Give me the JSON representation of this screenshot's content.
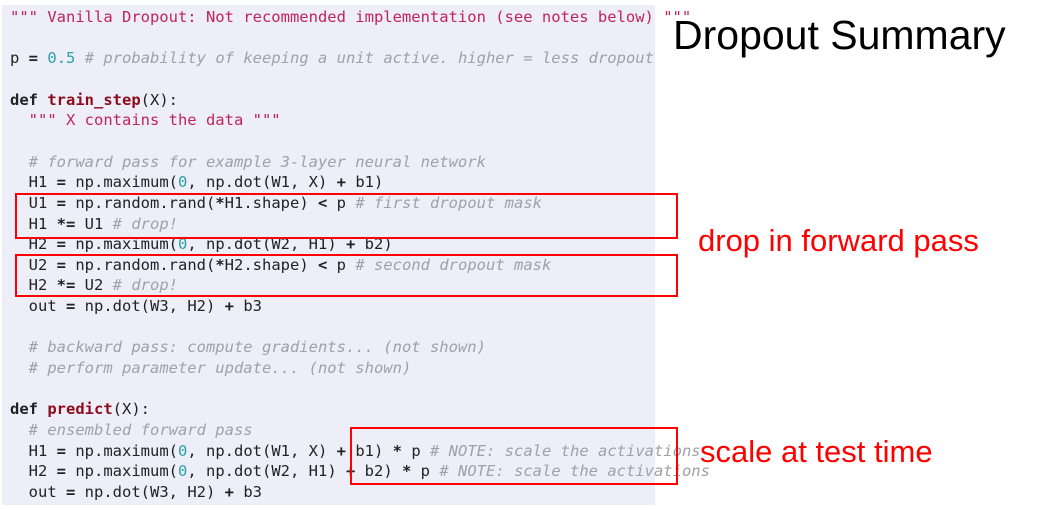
{
  "title": "Dropout Summary",
  "annotations": {
    "forward": "drop in forward pass",
    "test": "scale at test time"
  },
  "colors": {
    "highlight": "#ff0000",
    "code_bg": "#eeeef8",
    "string": "#c0245a",
    "comment": "#a0a0a8",
    "number": "#2aa1a6",
    "funcname": "#8b0b1a"
  },
  "code_lines": [
    [
      [
        "s",
        "\"\"\" Vanilla Dropout: Not recommended implementation (see notes below) \"\"\""
      ]
    ],
    [],
    [
      [
        "p",
        "p "
      ],
      [
        "o",
        "="
      ],
      [
        "p",
        " "
      ],
      [
        "n",
        "0.5"
      ],
      [
        "p",
        " "
      ],
      [
        "c",
        "# probability of keeping a unit active. higher = less dropout"
      ]
    ],
    [],
    [
      [
        "k",
        "def"
      ],
      [
        "p",
        " "
      ],
      [
        "f",
        "train_step"
      ],
      [
        "p",
        "(X):"
      ]
    ],
    [
      [
        "p",
        "  "
      ],
      [
        "s",
        "\"\"\" X contains the data \"\"\""
      ]
    ],
    [],
    [
      [
        "p",
        "  "
      ],
      [
        "c",
        "# forward pass for example 3-layer neural network"
      ]
    ],
    [
      [
        "p",
        "  H1 "
      ],
      [
        "o",
        "="
      ],
      [
        "p",
        " np.maximum("
      ],
      [
        "n",
        "0"
      ],
      [
        "p",
        ", np.dot(W1, X) "
      ],
      [
        "o",
        "+"
      ],
      [
        "p",
        " b1)"
      ]
    ],
    [
      [
        "p",
        "  U1 "
      ],
      [
        "o",
        "="
      ],
      [
        "p",
        " np.random.rand("
      ],
      [
        "o",
        "*"
      ],
      [
        "p",
        "H1.shape) "
      ],
      [
        "o",
        "<"
      ],
      [
        "p",
        " p "
      ],
      [
        "c",
        "# first dropout mask"
      ]
    ],
    [
      [
        "p",
        "  H1 "
      ],
      [
        "o",
        "*="
      ],
      [
        "p",
        " U1 "
      ],
      [
        "c",
        "# drop!"
      ]
    ],
    [
      [
        "p",
        "  H2 "
      ],
      [
        "o",
        "="
      ],
      [
        "p",
        " np.maximum("
      ],
      [
        "n",
        "0"
      ],
      [
        "p",
        ", np.dot(W2, H1) "
      ],
      [
        "o",
        "+"
      ],
      [
        "p",
        " b2)"
      ]
    ],
    [
      [
        "p",
        "  U2 "
      ],
      [
        "o",
        "="
      ],
      [
        "p",
        " np.random.rand("
      ],
      [
        "o",
        "*"
      ],
      [
        "p",
        "H2.shape) "
      ],
      [
        "o",
        "<"
      ],
      [
        "p",
        " p "
      ],
      [
        "c",
        "# second dropout mask"
      ]
    ],
    [
      [
        "p",
        "  H2 "
      ],
      [
        "o",
        "*="
      ],
      [
        "p",
        " U2 "
      ],
      [
        "c",
        "# drop!"
      ]
    ],
    [
      [
        "p",
        "  out "
      ],
      [
        "o",
        "="
      ],
      [
        "p",
        " np.dot(W3, H2) "
      ],
      [
        "o",
        "+"
      ],
      [
        "p",
        " b3"
      ]
    ],
    [],
    [
      [
        "p",
        "  "
      ],
      [
        "c",
        "# backward pass: compute gradients... (not shown)"
      ]
    ],
    [
      [
        "p",
        "  "
      ],
      [
        "c",
        "# perform parameter update... (not shown)"
      ]
    ],
    [],
    [
      [
        "k",
        "def"
      ],
      [
        "p",
        " "
      ],
      [
        "f",
        "predict"
      ],
      [
        "p",
        "(X):"
      ]
    ],
    [
      [
        "p",
        "  "
      ],
      [
        "c",
        "# ensembled forward pass"
      ]
    ],
    [
      [
        "p",
        "  H1 "
      ],
      [
        "o",
        "="
      ],
      [
        "p",
        " np.maximum("
      ],
      [
        "n",
        "0"
      ],
      [
        "p",
        ", np.dot(W1, X) "
      ],
      [
        "o",
        "+"
      ],
      [
        "p",
        " b1) "
      ],
      [
        "o",
        "*"
      ],
      [
        "p",
        " p "
      ],
      [
        "c",
        "# NOTE: scale the activations"
      ]
    ],
    [
      [
        "p",
        "  H2 "
      ],
      [
        "o",
        "="
      ],
      [
        "p",
        " np.maximum("
      ],
      [
        "n",
        "0"
      ],
      [
        "p",
        ", np.dot(W2, H1) "
      ],
      [
        "o",
        "+"
      ],
      [
        "p",
        " b2) "
      ],
      [
        "o",
        "*"
      ],
      [
        "p",
        " p "
      ],
      [
        "c",
        "# NOTE: scale the activations"
      ]
    ],
    [
      [
        "p",
        "  out "
      ],
      [
        "o",
        "="
      ],
      [
        "p",
        " np.dot(W3, H2) "
      ],
      [
        "o",
        "+"
      ],
      [
        "p",
        " b3"
      ]
    ]
  ]
}
